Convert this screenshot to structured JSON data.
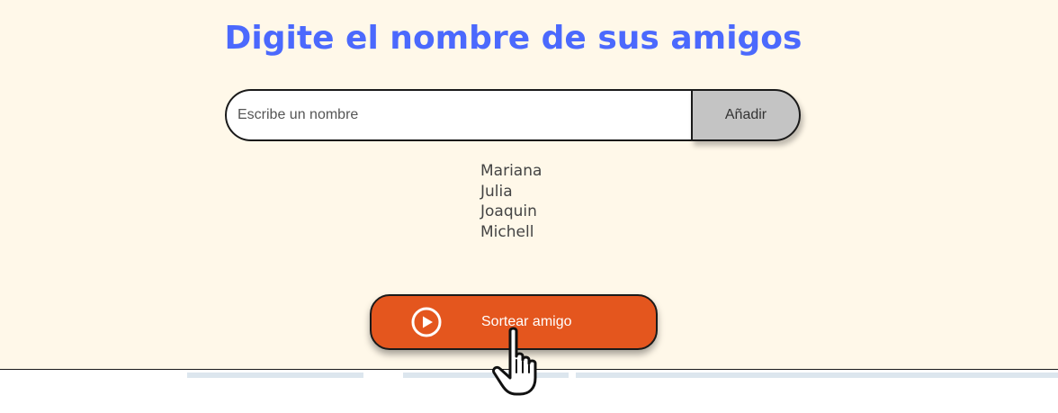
{
  "heading": "Digite el nombre de sus amigos",
  "input": {
    "placeholder": "Escribe un nombre",
    "value": ""
  },
  "add_button_label": "Añadir",
  "friends": [
    "Mariana",
    "Julia",
    "Joaquin",
    "Michell"
  ],
  "draw_button": {
    "label": "Sortear amigo",
    "icon": "play-circle-icon"
  },
  "colors": {
    "background": "#fff8e9",
    "heading": "#4b69fd",
    "draw_button": "#e4561e",
    "add_button": "#c4c4c4"
  },
  "cursor_icon": "hand-pointer-icon"
}
